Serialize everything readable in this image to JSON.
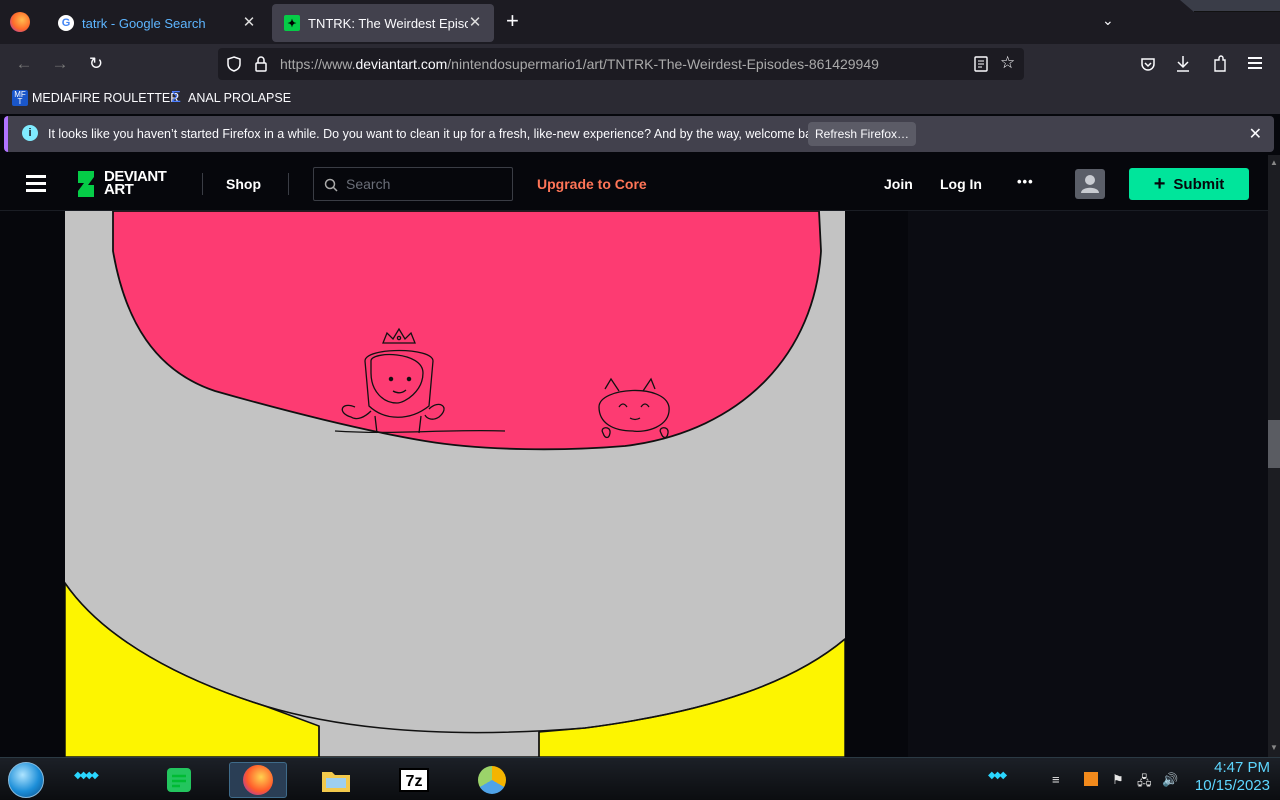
{
  "browser": {
    "tabs": [
      {
        "title": "tatrk - Google Search",
        "favicon": "google-icon",
        "active": false
      },
      {
        "title": "TNTRK: The Weirdest Episodes",
        "favicon": "deviantart-icon",
        "active": true
      }
    ],
    "new_tab_symbol": "+",
    "url": {
      "prefix": "https://www.",
      "domain": "deviantart.com",
      "path": "/nintendosupermario1/art/TNTRK-The-Weirdest-Episodes-861429949"
    },
    "bookmarks": [
      {
        "label": "MEDIAFIRE ROULETTER",
        "icon": "mediafire-icon",
        "icon_text": "MF T"
      },
      {
        "label": "ANAL PROLAPSE",
        "icon": "sigma-icon",
        "icon_text": "Σ"
      }
    ],
    "notification": {
      "message": "It looks like you haven’t started Firefox in a while. Do you want to clean it up for a fresh, like-new experience? And by the way, welcome back!",
      "button": "Refresh Firefox…"
    }
  },
  "site": {
    "logo_line1": "DEVIANT",
    "logo_line2": "ART",
    "shop": "Shop",
    "search_placeholder": "Search",
    "upgrade": "Upgrade to Core",
    "join": "Join",
    "login": "Log In",
    "more": "•••",
    "submit": "Submit",
    "colors": {
      "upgrade": "#ff7557",
      "submit": "#00e59b",
      "bg": "#06070c"
    }
  },
  "taskbar": {
    "time": "4:47 PM",
    "date": "10/15/2023",
    "apps": [
      "notes-icon",
      "firefox-icon",
      "file-explorer-icon",
      "7zip-icon",
      "chromium-icon"
    ],
    "sevenzip_label": "7z"
  }
}
